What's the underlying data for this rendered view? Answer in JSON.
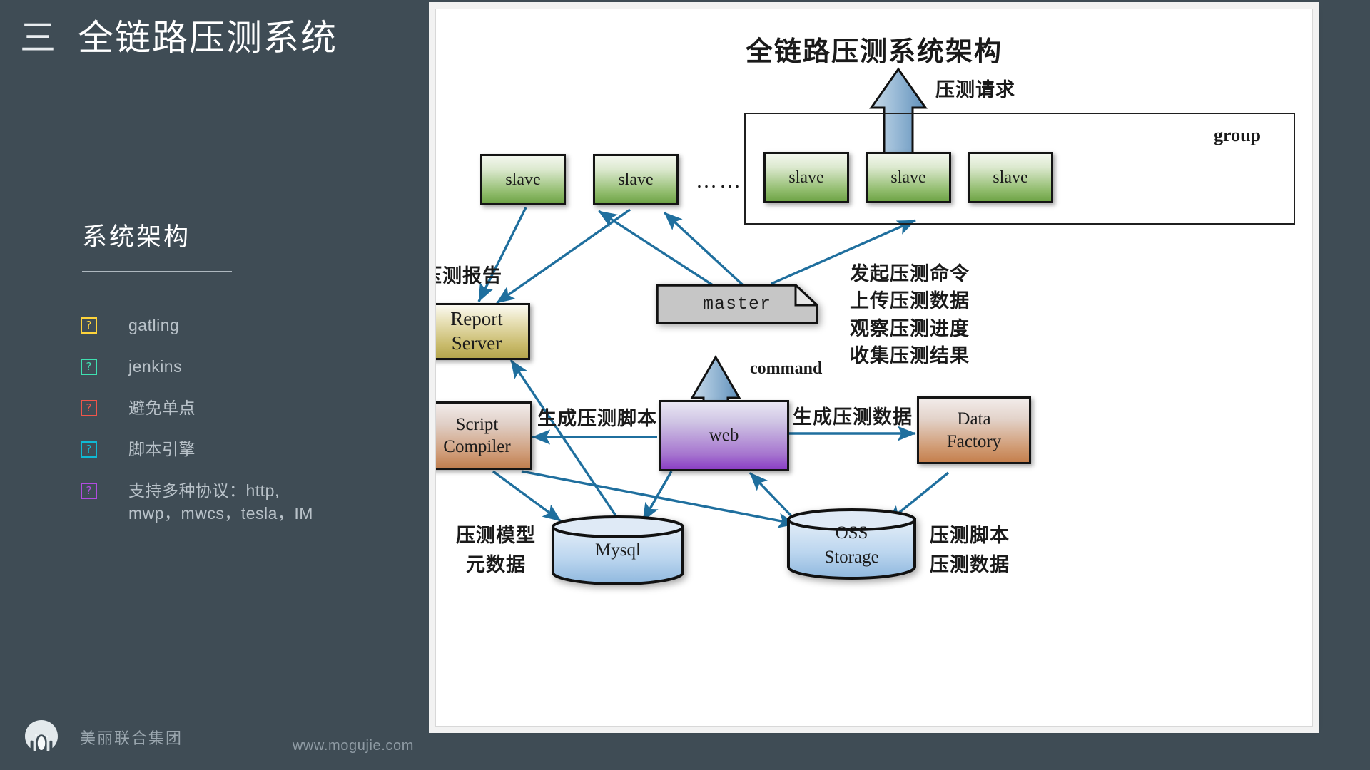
{
  "slide": {
    "section_number": "三",
    "title": "全链路压测系统",
    "subsection_title": "系统架构"
  },
  "bullets": [
    {
      "label": "gatling",
      "icon": "question-box-icon",
      "color": "#ffd43b",
      "gap_before": false
    },
    {
      "label": "jenkins",
      "icon": "question-box-icon",
      "color": "#3fe0b0",
      "gap_before": false
    },
    {
      "label": "避免单点",
      "icon": "question-box-icon",
      "color": "#f0554a",
      "gap_before": true
    },
    {
      "label": "脚本引擎",
      "icon": "question-box-icon",
      "color": "#0fb9d4",
      "gap_before": false
    },
    {
      "label": "支持多种协议：http,\nmwp，mwcs，tesla，IM",
      "icon": "question-box-icon",
      "color": "#b24ce0",
      "gap_before": false
    }
  ],
  "footer": {
    "brand": "美丽联合集团",
    "url": "www.mogujie.com",
    "logo_icon": "mogujie-mushroom-logo"
  },
  "diagram": {
    "title": "全链路压测系统架构",
    "group_label": "group",
    "ellipsis": "……",
    "nodes": {
      "slave1": "slave",
      "slave2": "slave",
      "slave3": "slave",
      "slave4": "slave",
      "slave5": "slave",
      "report_server": "Report\nServer",
      "master": "master",
      "script_compiler": "Script\nCompiler",
      "web": "web",
      "data_factory": "Data\nFactory",
      "mysql": "Mysql",
      "oss_storage": "OSS\nStorage"
    },
    "labels": {
      "stress_request": "压测请求",
      "upload_report": "上传压测报告",
      "master_ops": "发起压测命令\n上传压测数据\n观察压测进度\n收集压测结果",
      "command": "command",
      "generate_script": "生成压测脚本",
      "generate_data": "生成压测数据",
      "mysql_desc": "压测模型\n元数据",
      "oss_desc": "压测脚本\n压测数据"
    },
    "colors": {
      "arrow": "#1f6f9e",
      "big_arrow_fill": "#7fa8cc",
      "slave_fill": "#8fbb6b",
      "web_fill": "#a675cf",
      "report_fill": "#c9bb6c",
      "script_fill": "#cf9c78",
      "cylinder_fill": "#a9c9e8",
      "master_fill": "#b9b9b9"
    }
  }
}
